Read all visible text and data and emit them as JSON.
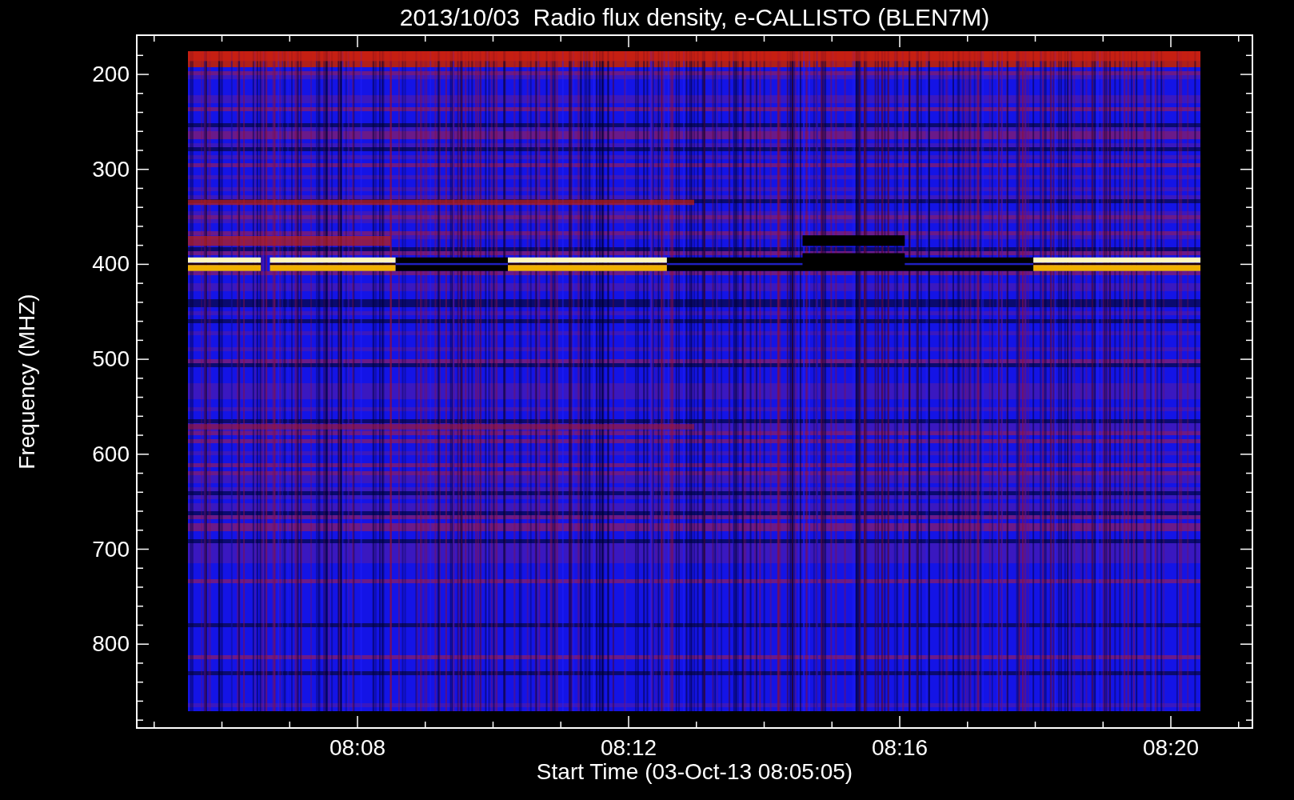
{
  "title": "2013/10/03  Radio flux density, e-CALLISTO (BLEN7M)",
  "y_axis": {
    "label": "Frequency (MHZ)",
    "ticks": [
      "200",
      "300",
      "400",
      "500",
      "600",
      "700",
      "800"
    ]
  },
  "x_axis": {
    "label": "Start Time (03-Oct-13 08:05:05)",
    "ticks": [
      "08:08",
      "08:12",
      "08:16",
      "08:20"
    ]
  }
}
